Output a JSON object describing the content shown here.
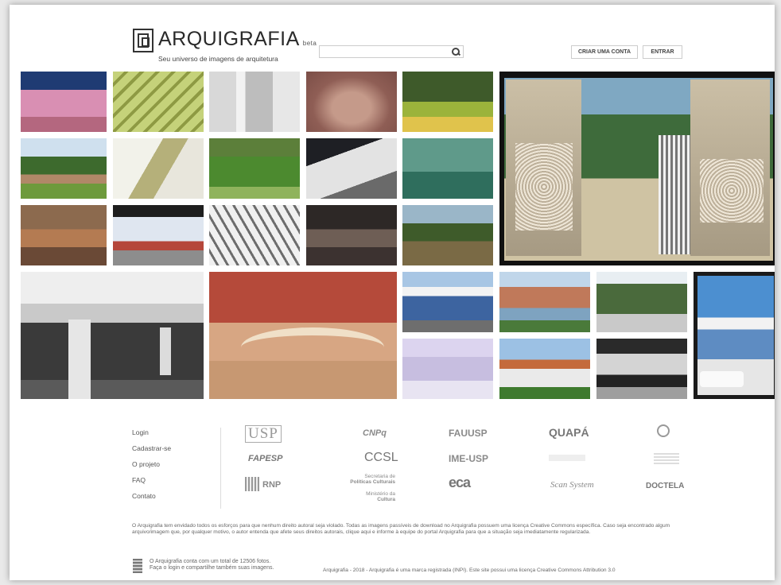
{
  "header": {
    "brand": "ARQUIGRAFIA",
    "beta": "beta",
    "tagline": "Seu universo de imagens de arquitetura",
    "search_placeholder": "",
    "create_account": "CRIAR UMA CONTA",
    "login": "ENTRAR"
  },
  "footer": {
    "links": [
      "Login",
      "Cadastrar-se",
      "O projeto",
      "FAQ",
      "Contato"
    ],
    "sponsors": {
      "usp": "USP",
      "cnpq": "CNPq",
      "fauusp": "FAUUSP",
      "quapa": "QUAPÁ",
      "fapesp": "FAPESP",
      "ccsl": "CCSL",
      "imeusp": "IME-USP",
      "rnp": "RNP",
      "secretaria_line1": "Secretaria de",
      "secretaria_line2": "Políticas Culturais",
      "ministerio_line1": "Ministério da",
      "ministerio_line2": "Cultura",
      "eca": "eca",
      "scan": "Scan System",
      "docteia": "DOCTELA"
    },
    "notice": "O Arquigrafia tem envidado todos os esforços para que nenhum direito autoral seja violado. Todas as imagens passíveis de download no Arquigrafia possuem uma licença Creative Commons específica. Caso seja encontrado algum arquivo/imagem que, por qualquer motivo, o autor entenda que afete seus direitos autorais, clique aqui e informe à equipe do portal Arquigrafia para que a situação seja imediatamente regularizada.",
    "count_line1": "O Arquigrafia conta com um total de 12506 fotos.",
    "count_line2": "Faça o login e compartilhe também suas imagens.",
    "copyright": "Arquigrafia - 2018 - Arquigrafia é uma marca registrada (INPI). Este site possui uma licença Creative Commons Attribution 3.0"
  },
  "gallery_alt": [
    "photo"
  ]
}
